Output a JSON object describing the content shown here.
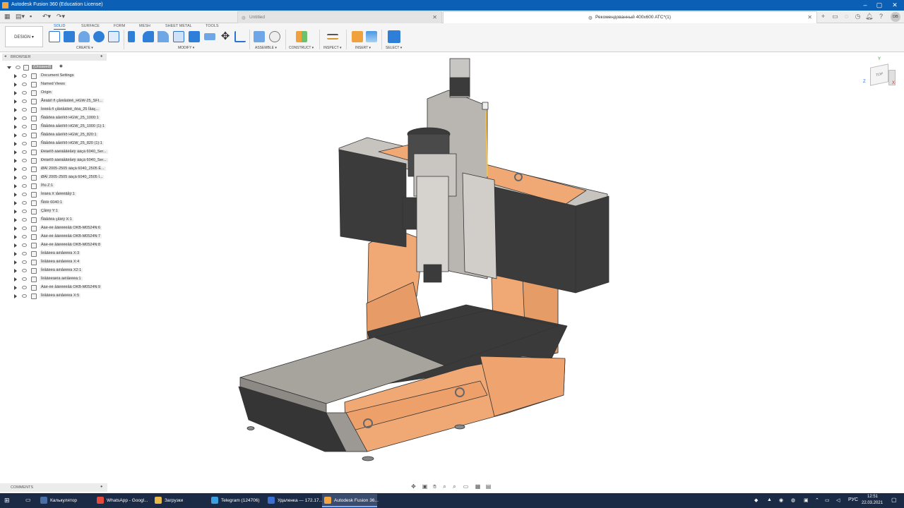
{
  "app": {
    "title": "Autodesk Fusion 360 (Education License)"
  },
  "tabs": [
    {
      "label": "Untitled",
      "active": false
    },
    {
      "label": "Рекомендованный 400x600 ATC*(1)",
      "active": true
    }
  ],
  "user": {
    "initials": "DB"
  },
  "ribbon": {
    "workspace": "DESIGN",
    "tabs": [
      "SOLID",
      "SURFACE",
      "FORM",
      "MESH",
      "SHEET METAL",
      "TOOLS"
    ],
    "active_tab": "SOLID",
    "groups": [
      "CREATE",
      "MODIFY",
      "ASSEMBLE",
      "CONSTRUCT",
      "INSPECT",
      "INSERT",
      "SELECT"
    ]
  },
  "browser": {
    "header": "BROWSER",
    "root": "(Unsaved)",
    "items": [
      {
        "label": "Document Settings",
        "icon": "gear-icon"
      },
      {
        "label": "Named Views",
        "icon": "folder-icon"
      },
      {
        "label": "Origin",
        "icon": "folder-icon"
      },
      {
        "label": "Ãëàâíî ñ çåìëåäîëê_HGW-25_SFI...",
        "icon": "component-icon"
      },
      {
        "label": "Ìèëëå ñ çåìëåäîëê_ðóá_25 Ïåáç...",
        "icon": "component-icon"
      },
      {
        "label": "Ñâåðëà áåòîííõ HGW_25_1000:1",
        "icon": "component-icon"
      },
      {
        "label": "Ñâåðëà áåòîííõ HGW_25_1000 (1):1",
        "icon": "component-icon"
      },
      {
        "label": "Ñâåðëà áåòîííõ HGW_25_820:1",
        "icon": "component-icon"
      },
      {
        "label": "Ñâåðëà áåòîííõ HGW_25_820 (1):1",
        "icon": "component-icon"
      },
      {
        "label": "Ðëàëîð áàëäåãëåéÿ ääçä 6040_Ser...",
        "icon": "component-icon"
      },
      {
        "label": "Ðëàëîð áàëäåãëåéÿ ääçä 6040_Ser...",
        "icon": "component-icon"
      },
      {
        "label": "ØÀÌ 2005-2505 ääçä 6040_2505 Ë...",
        "icon": "component-icon"
      },
      {
        "label": "ØÀÌ 2005-2505 ääçä 6040_2505 Ì...",
        "icon": "component-icon"
      },
      {
        "label": "Îñü Z:1",
        "icon": "body-icon"
      },
      {
        "label": "Ìëàëà X ïåëëëãåÿ:1",
        "icon": "body-icon"
      },
      {
        "label": "Ñòîë 6040:1",
        "icon": "body-icon"
      },
      {
        "label": "Çåìëÿ Y:1",
        "icon": "body-icon"
      },
      {
        "label": "Ñâåðëà çåìëÿ X:1",
        "icon": "body-icon"
      },
      {
        "label": "Àäè-ëè åâëëëèåâ OKB-M0524N:6",
        "icon": "body-icon"
      },
      {
        "label": "Àäè-ëè åâëëëèåâ OKB-M0524N:7",
        "icon": "body-icon"
      },
      {
        "label": "Àäè-ëè åâëëëèåâ OKB-M0524N:8",
        "icon": "body-icon"
      },
      {
        "label": "Ïëåãëèà äëìåëëèà X:3",
        "icon": "body-icon"
      },
      {
        "label": "Ïëåãëèà äëìåëëèà X:4",
        "icon": "body-icon"
      },
      {
        "label": "Ïëåãëèà äëìåëëèà X2:1",
        "icon": "body-icon"
      },
      {
        "label": "Ïëåãëèäëìà äëìåëëèà:1",
        "icon": "body-icon"
      },
      {
        "label": "Àäè-ëè åâëëëèåâ OKB-M0524N:9",
        "icon": "body-icon"
      },
      {
        "label": "Ïëåãëèà äëìåëëèà X:5",
        "icon": "body-icon"
      }
    ]
  },
  "comments": {
    "label": "COMMENTS"
  },
  "viewcube": {
    "face": "TOP",
    "axis_x": "X",
    "axis_y": "Y",
    "axis_z": "Z"
  },
  "taskbar": {
    "items": [
      {
        "label": "Калькулятор",
        "color": "#4a6fa5",
        "active": false
      },
      {
        "label": "WhatsApp - Googl...",
        "color": "#e7493a",
        "active": false
      },
      {
        "label": "Загрузки",
        "color": "#e8b84a",
        "active": false
      },
      {
        "label": "Telegram (124706)",
        "color": "#3aa0e0",
        "active": false
      },
      {
        "label": "Удаленка — 172.17...",
        "color": "#3b6fd0",
        "active": false
      },
      {
        "label": "Autodesk Fusion 36...",
        "color": "#f2a541",
        "active": true
      }
    ],
    "language": "РУС",
    "time": "12:51",
    "date": "22.03.2021"
  },
  "colors": {
    "titlebar": "#0b5fb5",
    "accent": "#0b6fd5",
    "machine_orange": "#f0a874",
    "machine_dark": "#3a3a3a",
    "machine_gray": "#b0aca6"
  }
}
